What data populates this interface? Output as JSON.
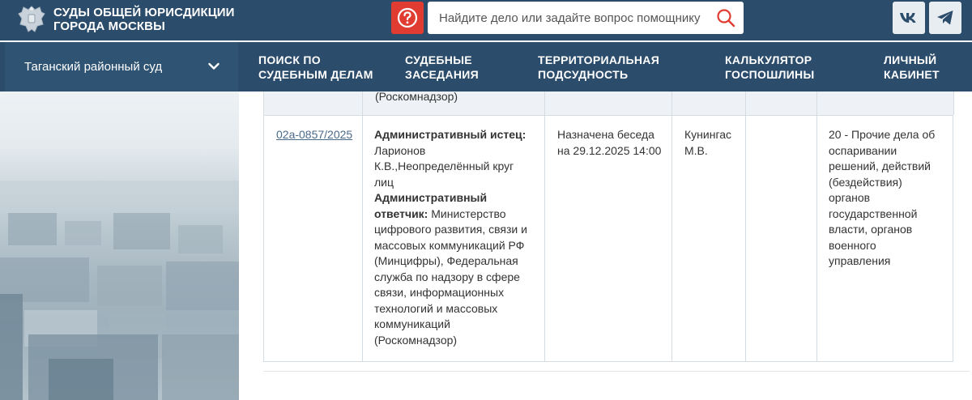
{
  "header": {
    "title_line1": "СУДЫ ОБЩЕЙ ЮРИСДИКЦИИ",
    "title_line2": "ГОРОДА МОСКВЫ",
    "help_icon": "question-icon",
    "search_placeholder": "Найдите дело или задайте вопрос помощнику",
    "search_icon": "search-icon",
    "social": [
      "vk-icon",
      "telegram-icon"
    ]
  },
  "nav": {
    "court": "Таганский районный суд",
    "items": [
      {
        "line1": "Поиск по",
        "line2": "судебным делам"
      },
      {
        "line1": "Судебные",
        "line2": "заседания"
      },
      {
        "line1": "Территориальная",
        "line2": "подсудность"
      },
      {
        "line1": "Калькулятор",
        "line2": "госпошлины"
      },
      {
        "line1": "Личный",
        "line2": "кабинет"
      }
    ]
  },
  "table": {
    "prev_row_tail": "(Роскомнадзор)",
    "row": {
      "case_number": "02а-0857/2025",
      "plaintiff_label": "Административный истец:",
      "plaintiff_lines": [
        "Ларионов",
        "К.В.,Неопределённый круг",
        "лиц"
      ],
      "defendant_label_1": "Административный",
      "defendant_label_2": "ответчик:",
      "defendant_first": " Министерство",
      "defendant_lines": [
        "цифрового развития, связи и",
        "массовых коммуникаций РФ",
        "(Минцифры), Федеральная",
        "служба по надзору в сфере",
        "связи, информационных",
        "технологий и массовых",
        "коммуникаций",
        "(Роскомнадзор)"
      ],
      "status_lines": [
        "Назначена беседа",
        "на 29.12.2025 14:00"
      ],
      "judge_lines": [
        "Кунингас",
        "М.В."
      ],
      "category_lines": [
        "20 - Прочие дела об",
        "оспаривании",
        "решений, действий",
        "(бездействия)",
        "органов",
        "государственной",
        "власти, органов",
        "военного",
        "управления"
      ]
    }
  },
  "colors": {
    "header_bg": "#2c4c6b",
    "help_red": "#e03c31",
    "link": "#4a6a8a"
  }
}
